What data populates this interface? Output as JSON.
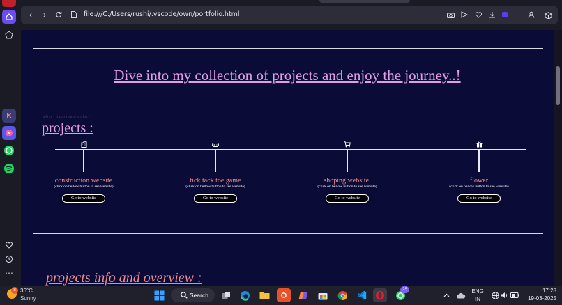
{
  "browser": {
    "url": "file:///C:/Users/rushi/.vscode/own/portfolio.html"
  },
  "page": {
    "hero_text": "Dive into my collection of projects and enjoy the journey..!",
    "subtitle": "what i have done so far :",
    "projects_heading": "projects :",
    "projects": [
      {
        "icon": "building-icon",
        "title": "construction website",
        "hint": "(click on bellow button to see website)",
        "button": "Go to website"
      },
      {
        "icon": "gamepad-icon",
        "title": "tick tack toe game",
        "hint": "(click on bellow button to see website)",
        "button": "Go to website"
      },
      {
        "icon": "cart-icon",
        "title": "shoping website.",
        "hint": "(click on bellow button to see website)",
        "button": "Go to website"
      },
      {
        "icon": "gift-icon",
        "title": "flower",
        "hint": "(click on bellow button to see website)",
        "button": "Go to website"
      }
    ],
    "info_heading": "projects info and overview :"
  },
  "taskbar": {
    "weather_temp": "36°C",
    "weather_desc": "Sunny",
    "weather_badge": "8",
    "search_label": "Search",
    "whatsapp_badge": "25",
    "lang_top": "ENG",
    "lang_bottom": "IN",
    "time": "17:28",
    "date": "19-03-2025"
  },
  "colors": {
    "page_bg": "#0b0b38",
    "accent_pink": "#e39ee3",
    "accent_coral": "#f08a8a"
  }
}
